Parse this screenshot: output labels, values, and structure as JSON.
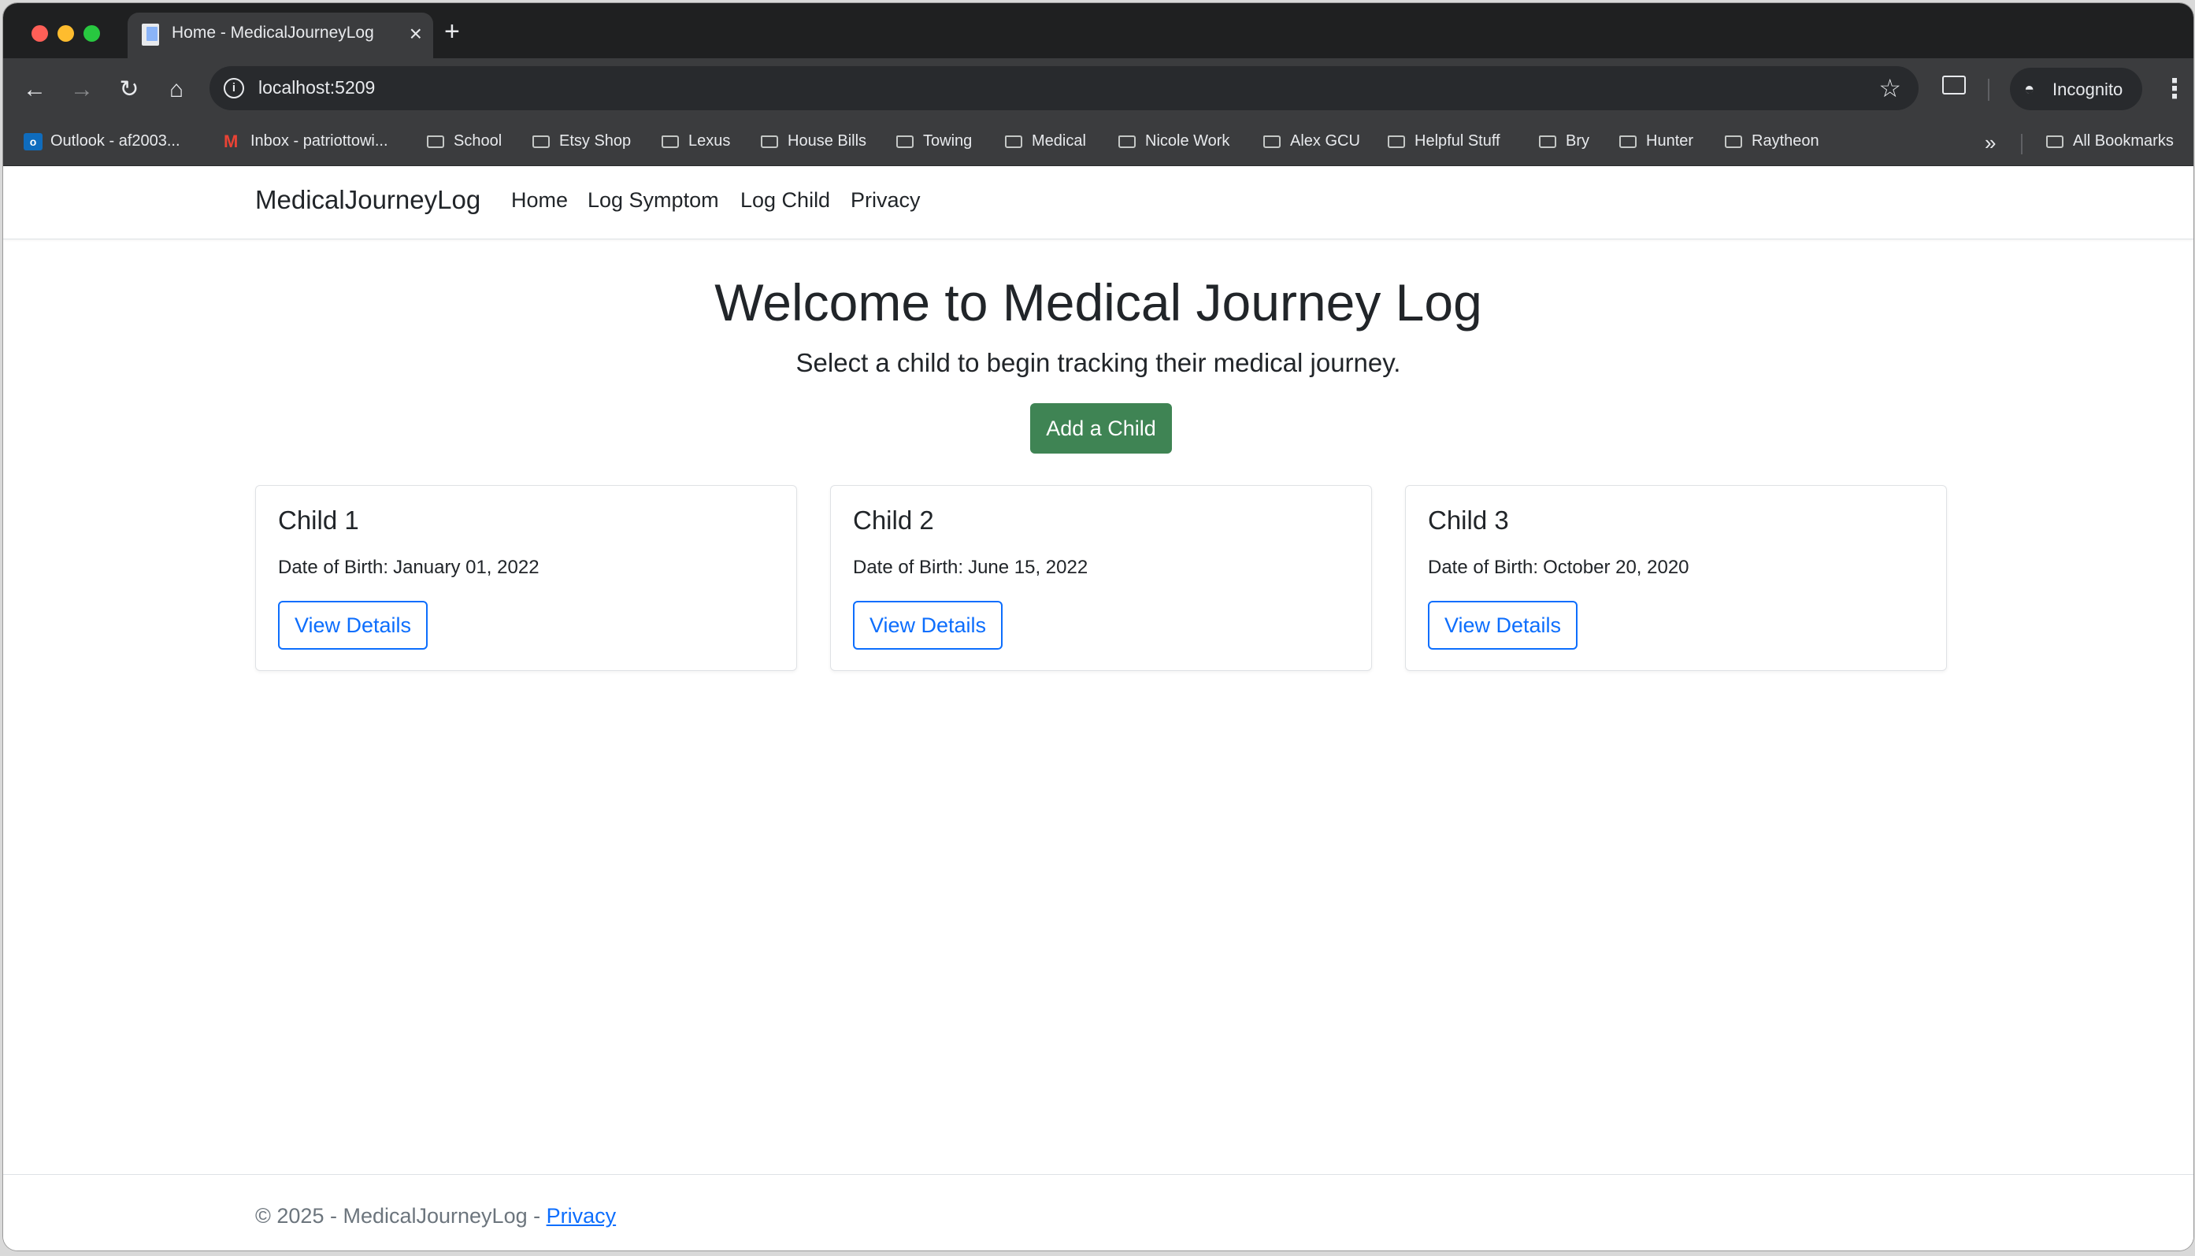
{
  "browser": {
    "tab_title": "Home - MedicalJourneyLog",
    "url": "localhost:5209",
    "profile_label": "Incognito",
    "bookmarks": [
      {
        "label": "Outlook - af2003...",
        "icon": "outlook-icon"
      },
      {
        "label": "Inbox - patriottowi...",
        "icon": "gmail-icon"
      },
      {
        "label": "School",
        "icon": "folder-icon"
      },
      {
        "label": "Etsy Shop",
        "icon": "folder-icon"
      },
      {
        "label": "Lexus",
        "icon": "folder-icon"
      },
      {
        "label": "House Bills",
        "icon": "folder-icon"
      },
      {
        "label": "Towing",
        "icon": "folder-icon"
      },
      {
        "label": "Medical",
        "icon": "folder-icon"
      },
      {
        "label": "Nicole Work",
        "icon": "folder-icon"
      },
      {
        "label": "Alex GCU",
        "icon": "folder-icon"
      },
      {
        "label": "Helpful Stuff",
        "icon": "folder-icon"
      },
      {
        "label": "Bry",
        "icon": "folder-icon"
      },
      {
        "label": "Hunter",
        "icon": "folder-icon"
      },
      {
        "label": "Raytheon",
        "icon": "folder-icon"
      }
    ],
    "all_bookmarks_label": "All Bookmarks"
  },
  "site": {
    "brand": "MedicalJourneyLog",
    "nav": [
      {
        "label": "Home"
      },
      {
        "label": "Log Symptom"
      },
      {
        "label": "Log Child"
      },
      {
        "label": "Privacy"
      }
    ]
  },
  "main": {
    "title": "Welcome to Medical Journey Log",
    "lead": "Select a child to begin tracking their medical journey.",
    "add_button": "Add a Child",
    "dob_label": "Date of Birth:",
    "children": [
      {
        "name": "Child 1",
        "dob": "January 01, 2022",
        "button": "View Details"
      },
      {
        "name": "Child 2",
        "dob": "June 15, 2022",
        "button": "View Details"
      },
      {
        "name": "Child 3",
        "dob": "October 20, 2020",
        "button": "View Details"
      }
    ]
  },
  "footer": {
    "text": "© 2025 - MedicalJourneyLog -",
    "link": "Privacy"
  },
  "colors": {
    "primary": "#0d6efd",
    "success": "#3f8454",
    "chrome_dark": "#1f2021",
    "chrome_toolbar": "#3b3c3e"
  }
}
